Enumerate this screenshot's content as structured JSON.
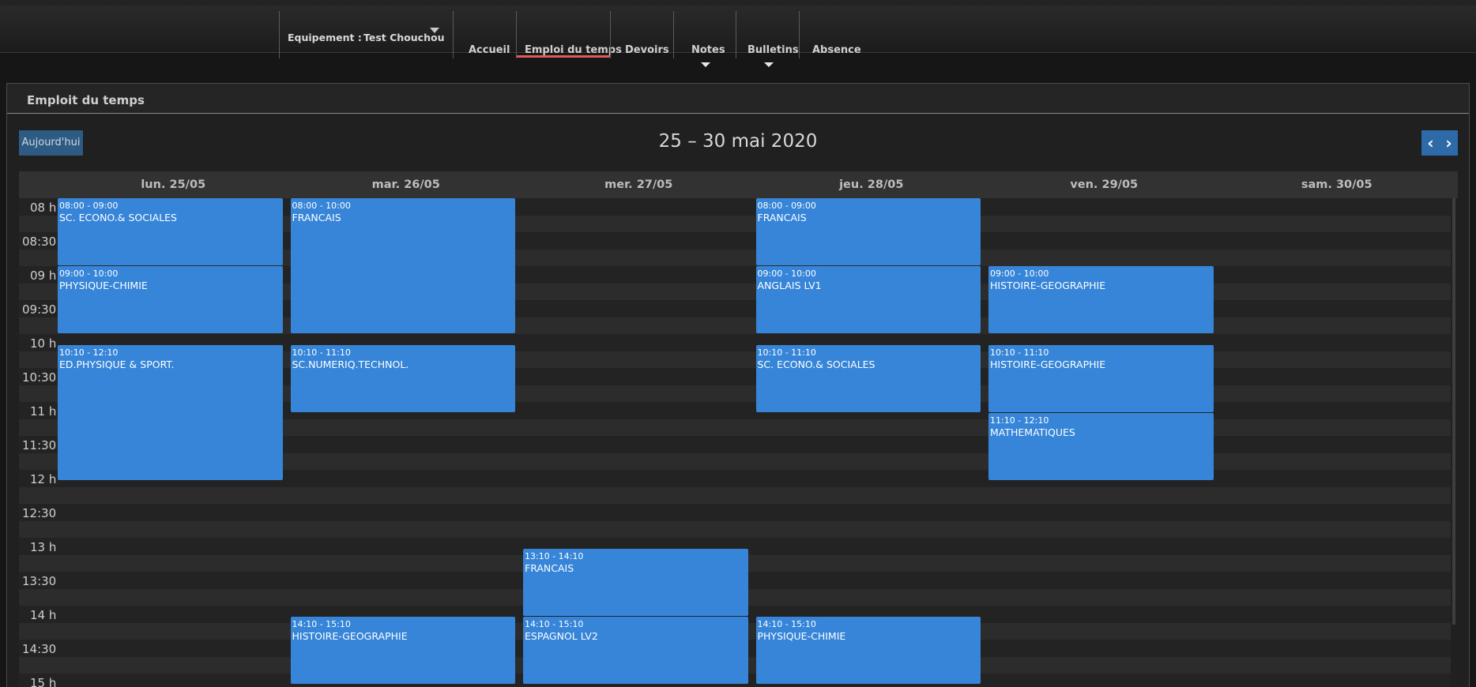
{
  "nav": {
    "equip_label": "Equipement :",
    "equip_value": "Test Chouchou",
    "items": [
      "Accueil",
      "Emploi du temps",
      "Devoirs",
      "Notes",
      "Bulletins",
      "Absence"
    ],
    "active": "Emploi du temps"
  },
  "panel": {
    "title": "Emploit du temps"
  },
  "calendar": {
    "today_label": "Aujourd'hui",
    "title": "25 – 30 mai 2020",
    "prev_icon": "‹",
    "next_icon": "›",
    "days": [
      "lun. 25/05",
      "mar. 26/05",
      "mer. 27/05",
      "jeu. 28/05",
      "ven. 29/05",
      "sam. 30/05"
    ],
    "times": [
      "08 h",
      "08:30",
      "09 h",
      "09:30",
      "10 h",
      "10:30",
      "11 h",
      "11:30",
      "12 h",
      "12:30",
      "13 h",
      "13:30",
      "14 h",
      "14:30",
      "15 h"
    ],
    "events": [
      {
        "day": 0,
        "start": "08:00",
        "end": "09:00",
        "time": "08:00 - 09:00",
        "name": "SC. ECONO.& SOCIALES"
      },
      {
        "day": 0,
        "start": "09:00",
        "end": "10:00",
        "time": "09:00 - 10:00",
        "name": "PHYSIQUE-CHIMIE"
      },
      {
        "day": 0,
        "start": "10:10",
        "end": "12:10",
        "time": "10:10 - 12:10",
        "name": "ED.PHYSIQUE & SPORT."
      },
      {
        "day": 1,
        "start": "08:00",
        "end": "10:00",
        "time": "08:00 - 10:00",
        "name": "FRANCAIS"
      },
      {
        "day": 1,
        "start": "10:10",
        "end": "11:10",
        "time": "10:10 - 11:10",
        "name": "SC.NUMERIQ.TECHNOL."
      },
      {
        "day": 1,
        "start": "14:10",
        "end": "15:10",
        "time": "14:10 - 15:10",
        "name": "HISTOIRE-GEOGRAPHIE"
      },
      {
        "day": 2,
        "start": "13:10",
        "end": "14:10",
        "time": "13:10 - 14:10",
        "name": "FRANCAIS"
      },
      {
        "day": 2,
        "start": "14:10",
        "end": "15:10",
        "time": "14:10 - 15:10",
        "name": "ESPAGNOL LV2"
      },
      {
        "day": 3,
        "start": "08:00",
        "end": "09:00",
        "time": "08:00 - 09:00",
        "name": "FRANCAIS"
      },
      {
        "day": 3,
        "start": "09:00",
        "end": "10:00",
        "time": "09:00 - 10:00",
        "name": "ANGLAIS LV1"
      },
      {
        "day": 3,
        "start": "10:10",
        "end": "11:10",
        "time": "10:10 - 11:10",
        "name": "SC. ECONO.& SOCIALES"
      },
      {
        "day": 3,
        "start": "14:10",
        "end": "15:10",
        "time": "14:10 - 15:10",
        "name": "PHYSIQUE-CHIMIE"
      },
      {
        "day": 4,
        "start": "09:00",
        "end": "10:00",
        "time": "09:00 - 10:00",
        "name": "HISTOIRE-GEOGRAPHIE"
      },
      {
        "day": 4,
        "start": "10:10",
        "end": "11:10",
        "time": "10:10 - 11:10",
        "name": "HISTOIRE-GEOGRAPHIE"
      },
      {
        "day": 4,
        "start": "11:10",
        "end": "12:10",
        "time": "11:10 - 12:10",
        "name": "MATHEMATIQUES"
      }
    ]
  },
  "colors": {
    "event": "#3685d8",
    "active_underline": "#e05a5a",
    "button": "#2e6aa8"
  }
}
